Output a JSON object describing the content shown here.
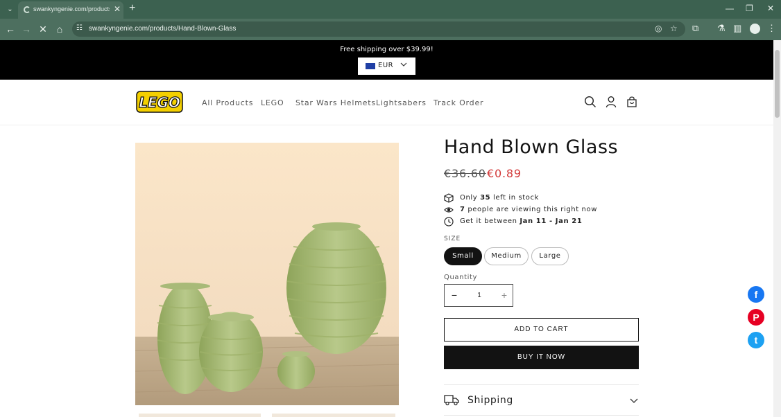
{
  "browser": {
    "tab_title": "swankyngenie.com/products/H",
    "url": "swankyngenie.com/products/Hand-Blown-Glass"
  },
  "announcement": {
    "text": "Free shipping over $39.99!",
    "currency": "EUR"
  },
  "header": {
    "logo_text": "LEGO",
    "nav": [
      "All Products",
      "LEGO",
      "Star Wars Helmets",
      "Lightsabers",
      "Track Order"
    ]
  },
  "product": {
    "title": "Hand Blown Glass",
    "price_old": "€36.60",
    "price_new": "€0.89",
    "stock": {
      "pre": "Only ",
      "count": "35",
      "post": " left in stock"
    },
    "viewers": {
      "count": "7",
      "post": " people are viewing this right now"
    },
    "delivery": {
      "pre": "Get it between ",
      "range": "Jan 11 - Jan 21"
    },
    "size_label": "SIZE",
    "sizes": [
      "Small",
      "Medium",
      "Large"
    ],
    "selected_size": "Small",
    "quantity_label": "Quantity",
    "quantity": "1",
    "add_to_cart": "ADD TO CART",
    "buy_now": "BUY IT NOW",
    "shipping_label": "Shipping"
  },
  "colors": {
    "accent_price": "#d33a3a",
    "facebook": "#1877f2",
    "pinterest": "#e60023",
    "twitter": "#1da1f2"
  }
}
